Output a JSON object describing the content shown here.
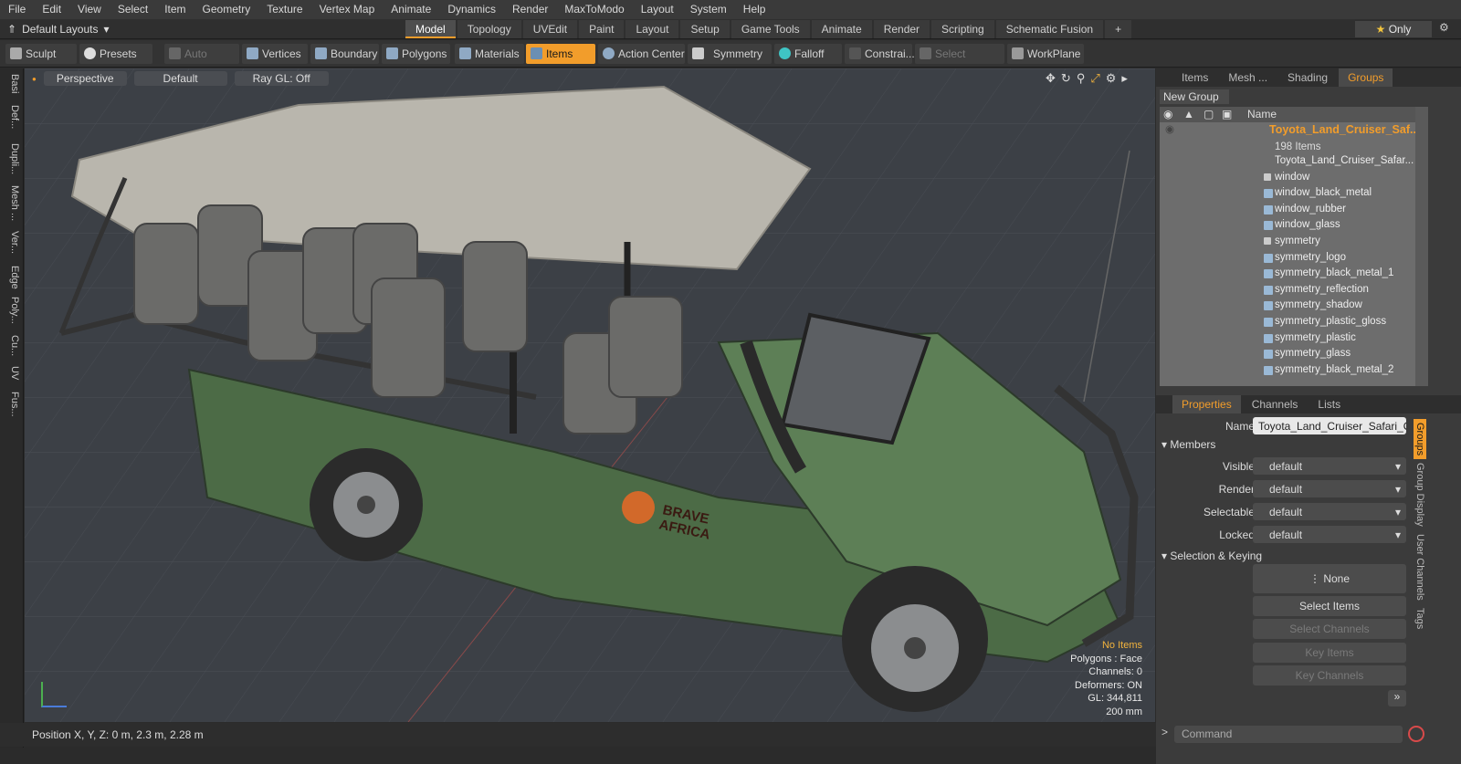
{
  "menu": [
    "File",
    "Edit",
    "View",
    "Select",
    "Item",
    "Geometry",
    "Texture",
    "Vertex Map",
    "Animate",
    "Dynamics",
    "Render",
    "MaxToModo",
    "Layout",
    "System",
    "Help"
  ],
  "layouts_label": "Default Layouts",
  "tabs": [
    "Model",
    "Topology",
    "UVEdit",
    "Paint",
    "Layout",
    "Setup",
    "Game Tools",
    "Animate",
    "Render",
    "Scripting",
    "Schematic Fusion"
  ],
  "only_label": "Only",
  "toolbar": {
    "sculpt": "Sculpt",
    "presets": "Presets",
    "auto_select": "Auto Select",
    "vertices": "Vertices",
    "boundary": "Boundary",
    "polygons": "Polygons",
    "materials": "Materials",
    "items": "Items",
    "action_center": "Action Center",
    "symmetry": "Symmetry",
    "falloff": "Falloff",
    "constrain": "Constrai...",
    "select_through": "Select Through",
    "workplane": "WorkPlane"
  },
  "left_tabs": [
    "Basi",
    "Def...",
    "Dupli...",
    "Mesh ...",
    "Ver...",
    "Edge",
    "Poly...",
    "Cu...",
    "UV",
    "Fus..."
  ],
  "viewport": {
    "perspective": "Perspective",
    "default": "Default",
    "raygl": "Ray GL: Off"
  },
  "hud": {
    "no_items": "No Items",
    "polygons": "Polygons : Face",
    "channels": "Channels: 0",
    "deformers": "Deformers: ON",
    "gl": "GL: 344,811",
    "size": "200 mm"
  },
  "status": "Position X, Y, Z:  0 m, 2.3 m, 2.28 m",
  "panel": {
    "tabs": [
      "Items",
      "Mesh ...",
      "Shading",
      "Groups"
    ],
    "new_group": "New Group",
    "name_header": "Name",
    "root": "Toyota_Land_Cruiser_Saf...",
    "root_count": "198 Items",
    "items": [
      "Toyota_Land_Cruiser_Safar...",
      "window",
      "window_black_metal",
      "window_rubber",
      "window_glass",
      "symmetry",
      "symmetry_logo",
      "symmetry_black_metal_1",
      "symmetry_reflection",
      "symmetry_shadow",
      "symmetry_plastic_gloss",
      "symmetry_plastic",
      "symmetry_glass",
      "symmetry_black_metal_2"
    ]
  },
  "props": {
    "tabs": [
      "Properties",
      "Channels",
      "Lists"
    ],
    "name_label": "Name",
    "name_value": "Toyota_Land_Cruiser_Safari_Ope",
    "members": "Members",
    "visible": "Visible",
    "render": "Render",
    "selectable": "Selectable",
    "locked": "Locked",
    "default": "default",
    "sel_keying": "Selection & Keying",
    "none": "None",
    "select_items": "Select Items",
    "select_channels": "Select Channels",
    "key_items": "Key Items",
    "key_channels": "Key Channels",
    "side_tabs": [
      "Groups",
      "Group Display",
      "User Channels",
      "Tags"
    ]
  },
  "command_placeholder": "Command"
}
